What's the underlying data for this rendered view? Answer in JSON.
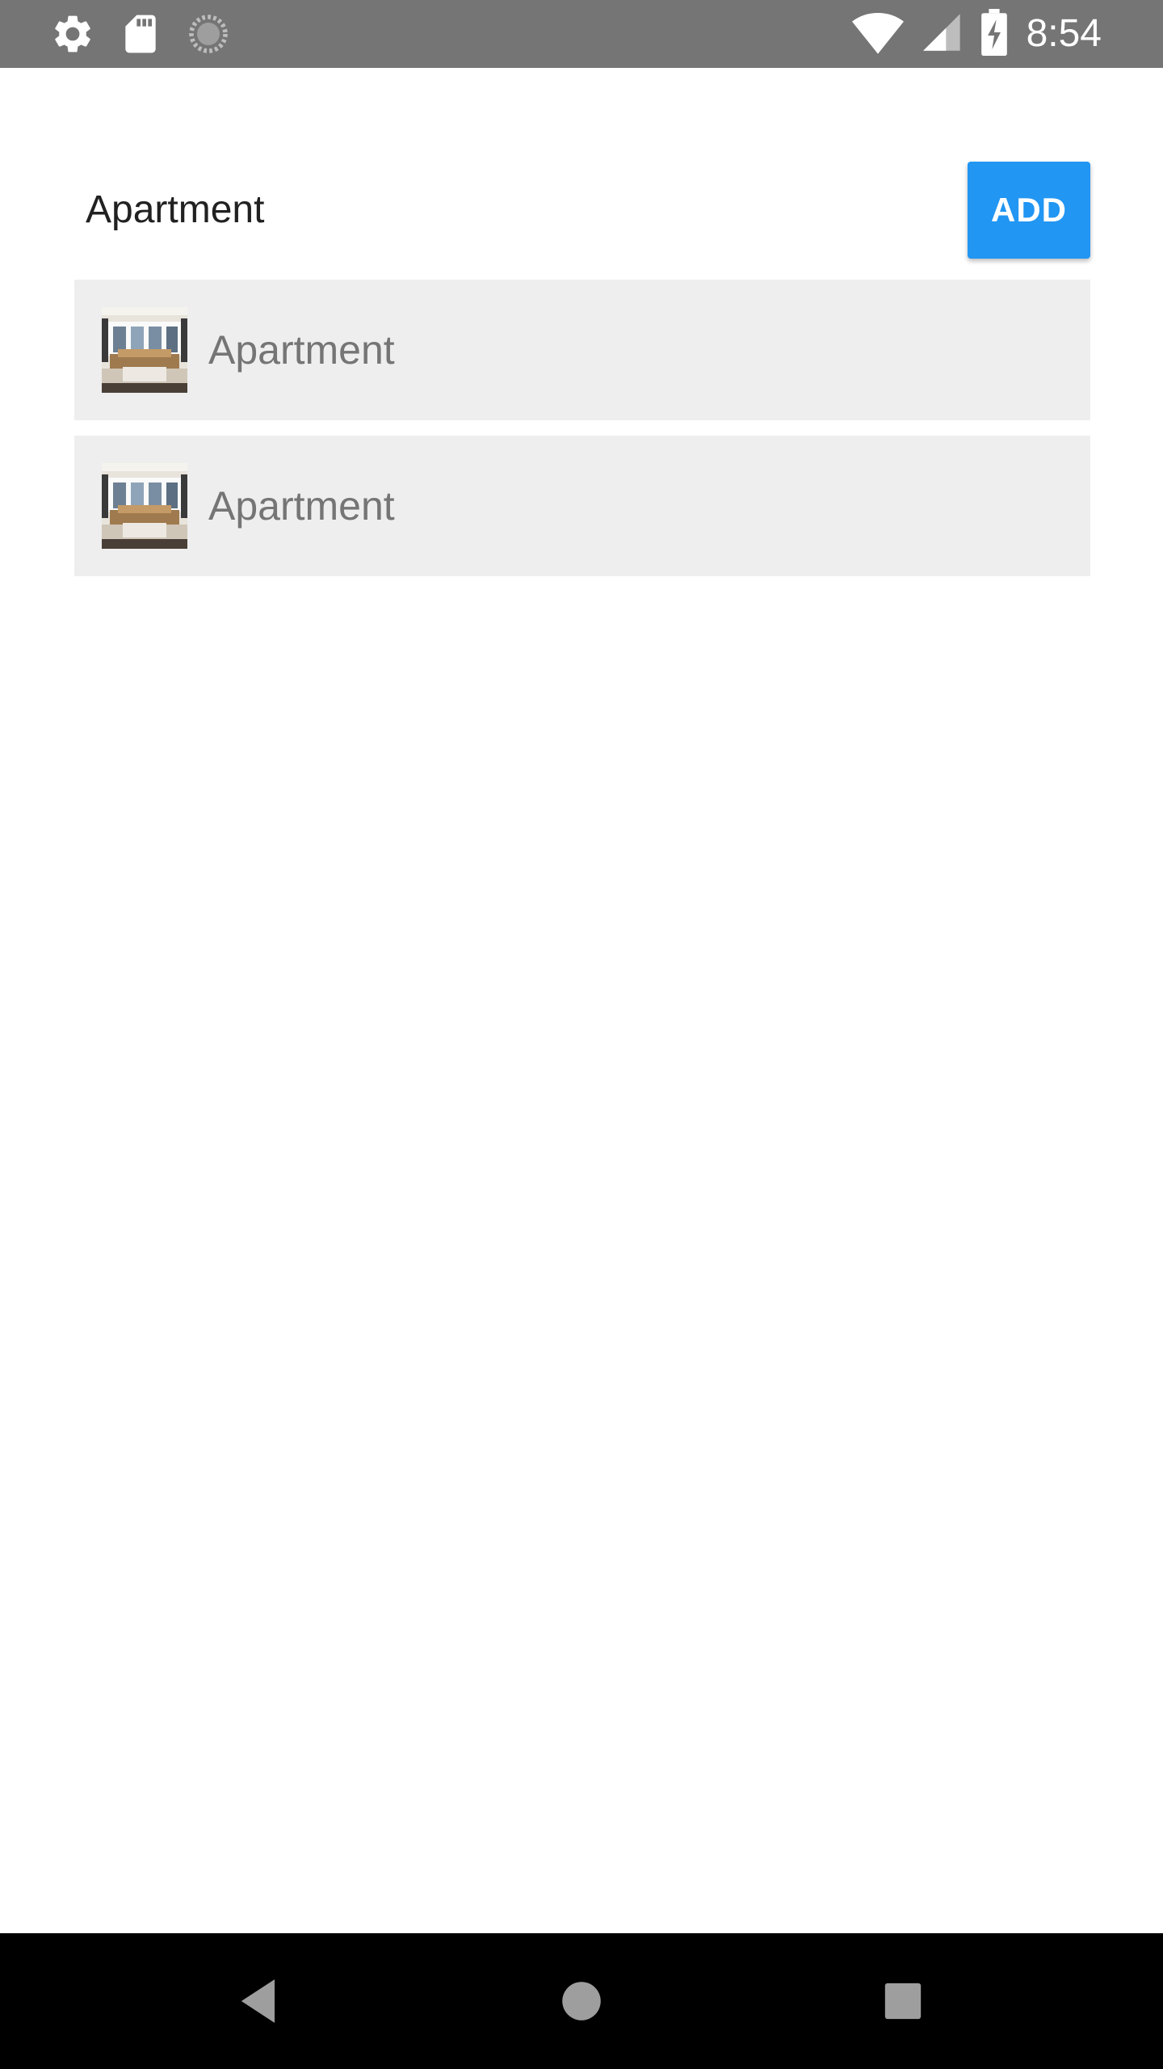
{
  "status_bar": {
    "time": "8:54",
    "icons": [
      "gear-icon",
      "sd-card-icon",
      "sync-spinner-icon",
      "wifi-icon",
      "cell-signal-icon",
      "battery-charging-icon"
    ],
    "background": "#757575"
  },
  "header": {
    "title": "Apartment",
    "add_label": "ADD",
    "accent": "#2196f3"
  },
  "list": {
    "items": [
      {
        "label": "Apartment",
        "thumbnail": "apartment-photo"
      },
      {
        "label": "Apartment",
        "thumbnail": "apartment-photo"
      }
    ]
  },
  "nav_bar": {
    "icons": [
      "back-icon",
      "home-icon",
      "recents-icon"
    ]
  }
}
